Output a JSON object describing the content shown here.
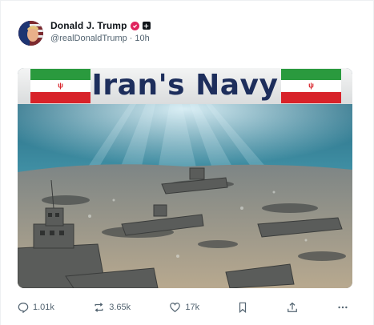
{
  "post": {
    "author": {
      "name": "Donald J. Trump",
      "handle": "@realDonaldTrump",
      "separator": "·",
      "time": "10h"
    },
    "media": {
      "banner_title": "Iran's Navy"
    },
    "actions": {
      "replies": "1.01k",
      "reposts": "3.65k",
      "likes": "17k"
    }
  },
  "icons": [
    "avatar",
    "verified-badge-icon",
    "affiliate-badge-icon",
    "reply-icon",
    "repost-icon",
    "like-icon",
    "bookmark-icon",
    "share-icon",
    "more-icon"
  ],
  "colors": {
    "verified_badge": "#e0245e",
    "secondary_text": "#536471",
    "banner_text": "#1d2e5c"
  }
}
